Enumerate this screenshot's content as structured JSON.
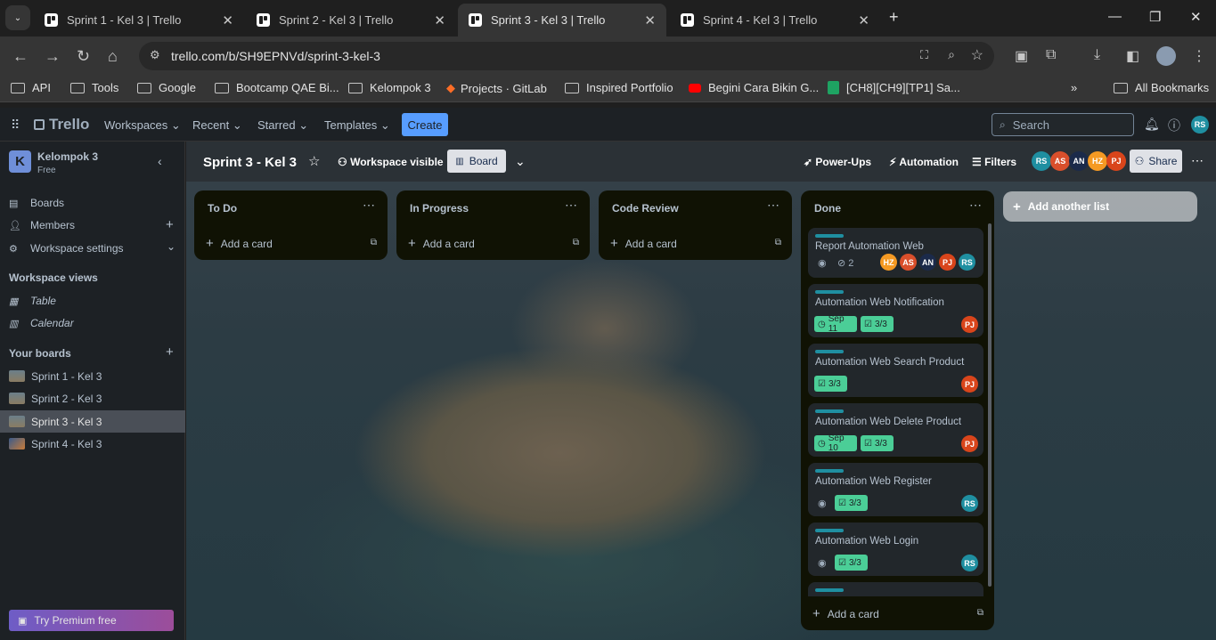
{
  "browser": {
    "tabs": [
      {
        "title": "Sprint 1 - Kel 3 | Trello"
      },
      {
        "title": "Sprint 2 - Kel 3 | Trello"
      },
      {
        "title": "Sprint 3 - Kel 3 | Trello"
      },
      {
        "title": "Sprint 4 - Kel 3 | Trello"
      }
    ],
    "url": "trello.com/b/SH9EPNVd/sprint-3-kel-3",
    "bookmarks": [
      "API",
      "Tools",
      "Google",
      "Bootcamp QAE Bi...",
      "Kelompok 3",
      "Projects · GitLab",
      "Inspired Portfolio",
      "Begini Cara Bikin G...",
      "[CH8][CH9][TP1] Sa..."
    ],
    "all_bookmarks": "All Bookmarks"
  },
  "trello": {
    "logo": "Trello",
    "menu": {
      "workspaces": "Workspaces",
      "recent": "Recent",
      "starred": "Starred",
      "templates": "Templates"
    },
    "create": "Create",
    "search_placeholder": "Search",
    "me_initials": "RS"
  },
  "sidebar": {
    "workspace_initial": "K",
    "workspace_name": "Kelompok 3",
    "workspace_plan": "Free",
    "items": {
      "boards": "Boards",
      "members": "Members",
      "settings": "Workspace settings"
    },
    "views_header": "Workspace views",
    "views": {
      "table": "Table",
      "calendar": "Calendar"
    },
    "boards_header": "Your boards",
    "boards": [
      "Sprint 1 - Kel 3",
      "Sprint 2 - Kel 3",
      "Sprint 3 - Kel 3",
      "Sprint 4 - Kel 3"
    ],
    "premium": "Try Premium free"
  },
  "board": {
    "title": "Sprint 3 - Kel 3",
    "visibility": "Workspace visible",
    "view": "Board",
    "powerups": "Power-Ups",
    "automation": "Automation",
    "filters": "Filters",
    "share": "Share",
    "members": [
      {
        "initials": "RS",
        "color": "#1f8fa1"
      },
      {
        "initials": "AS",
        "color": "#d94f2b"
      },
      {
        "initials": "AN",
        "color": "#1b2a4a"
      },
      {
        "initials": "HZ",
        "color": "#f59a23"
      },
      {
        "initials": "PJ",
        "color": "#d9451b"
      }
    ],
    "add_card": "Add a card",
    "add_list": "Add another list",
    "lists": {
      "todo": "To Do",
      "progress": "In Progress",
      "review": "Code Review",
      "done": "Done"
    },
    "done_cards": {
      "c1": {
        "title": "Report Automation Web",
        "attachments": "2",
        "members": [
          "HZ",
          "AS",
          "AN",
          "PJ",
          "RS"
        ]
      },
      "c2": {
        "title": "Automation Web Notification",
        "date": "Sep 11",
        "checklist": "3/3",
        "member": "PJ"
      },
      "c3": {
        "title": "Automation Web Search Product",
        "checklist": "3/3",
        "member": "PJ"
      },
      "c4": {
        "title": "Automation Web Delete Product",
        "date": "Sep 10",
        "checklist": "3/3",
        "member": "PJ"
      },
      "c5": {
        "title": "Automation Web Register",
        "checklist": "3/3",
        "member": "RS"
      },
      "c6": {
        "title": "Automation Web Login",
        "checklist": "3/3",
        "member": "RS"
      }
    }
  }
}
